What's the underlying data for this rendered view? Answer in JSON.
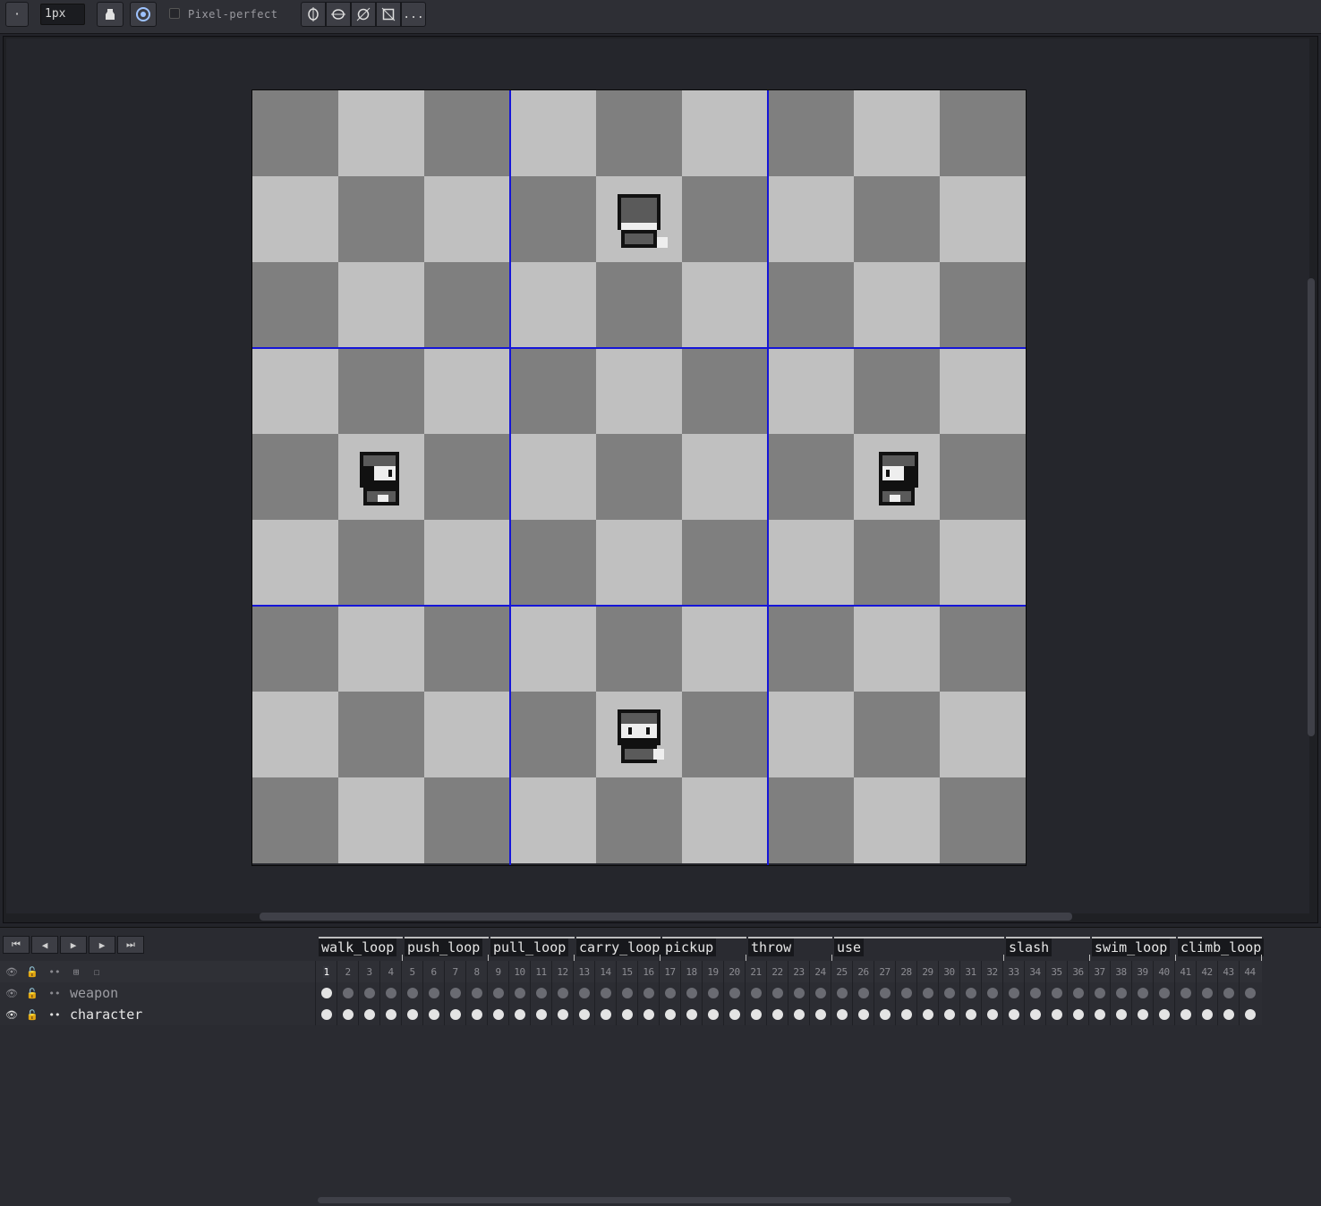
{
  "toolbar": {
    "brush_size": "1px",
    "pixel_perfect_label": "Pixel-perfect",
    "more_label": "..."
  },
  "tags": [
    "walk_loop",
    "push_loop",
    "pull_loop",
    "carry_loop",
    "pickup",
    "throw",
    "use",
    "slash",
    "swim_loop",
    "climb_loop"
  ],
  "layers": [
    {
      "name": "weapon"
    },
    {
      "name": "character"
    }
  ],
  "frames": [
    "1",
    "2",
    "3",
    "4",
    "5",
    "6",
    "7",
    "8",
    "9",
    "10",
    "11",
    "12",
    "13",
    "14",
    "15",
    "16",
    "17",
    "18",
    "19",
    "20",
    "21",
    "22",
    "23",
    "24",
    "25",
    "26",
    "27",
    "28",
    "29",
    "30",
    "31",
    "32",
    "33",
    "34",
    "35",
    "36",
    "37",
    "38",
    "39",
    "40",
    "41",
    "42",
    "43",
    "44"
  ],
  "current_frame": "1",
  "colors": {
    "checker_dark": "#7f7f7f",
    "checker_light": "#c0c0c0",
    "grid": "#1515d8"
  }
}
